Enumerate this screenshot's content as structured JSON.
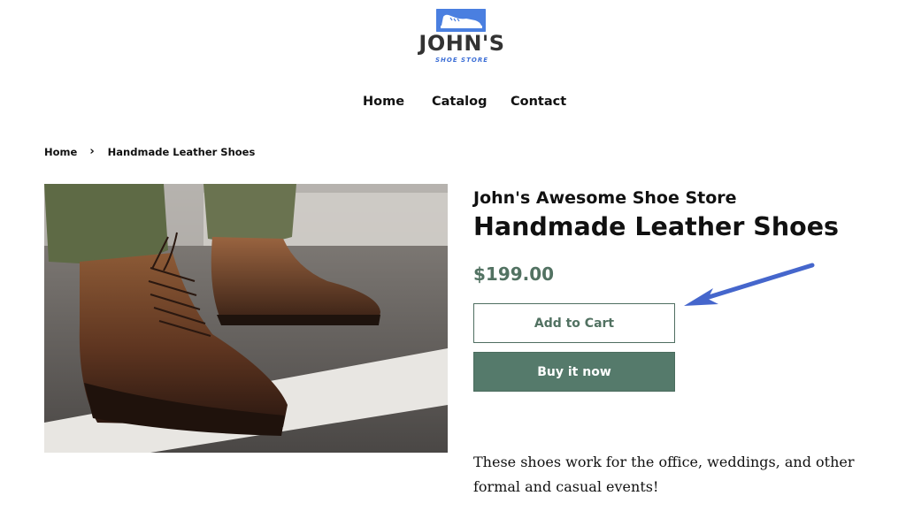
{
  "logo": {
    "name": "JOHN'S",
    "subtitle": "SHOE STORE",
    "brand_color": "#4a7fe0",
    "icon": "sneaker-icon"
  },
  "nav": {
    "items": [
      {
        "label": "Home"
      },
      {
        "label": "Catalog"
      },
      {
        "label": "Contact"
      }
    ]
  },
  "breadcrumb": {
    "home": "Home",
    "separator": "›",
    "current": "Handmade Leather Shoes"
  },
  "product": {
    "image_alt": "leather-boots-photo",
    "store_name": "John's Awesome Shoe Store",
    "title": "Handmade Leather Shoes",
    "price": "$199.00",
    "add_to_cart_label": "Add to Cart",
    "buy_now_label": "Buy it now",
    "description": "These shoes work for the office, weddings, and other formal and casual events!"
  },
  "annotation": {
    "icon": "arrow-icon",
    "color": "#4566cc"
  },
  "colors": {
    "accent": "#557a6b",
    "price": "#527262"
  }
}
